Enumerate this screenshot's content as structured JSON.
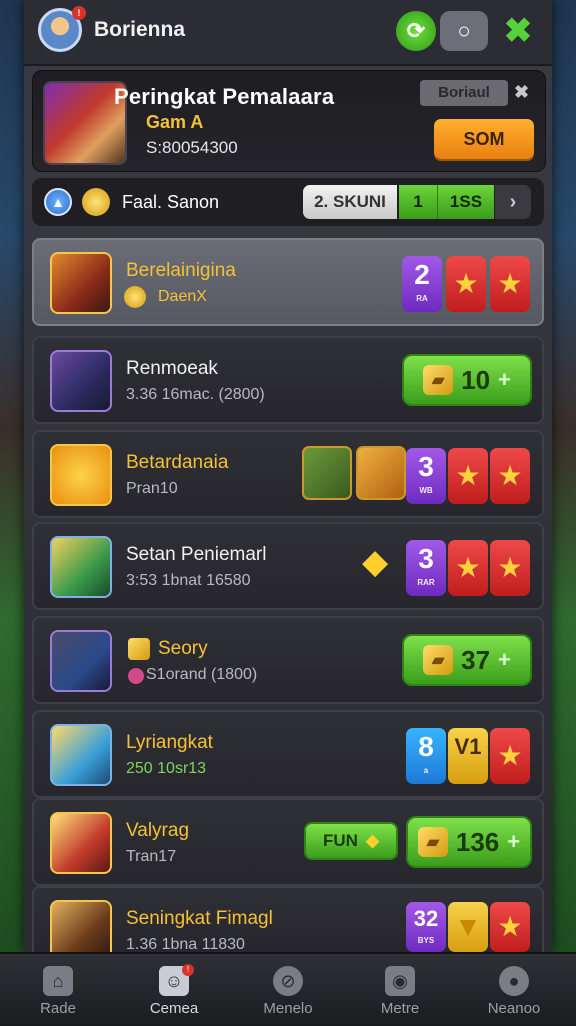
{
  "header": {
    "title": "Borienna",
    "avatar_badge": "!",
    "icons": [
      "refresh-icon",
      "settings-icon",
      "close-icon"
    ]
  },
  "profile": {
    "title": "Peringkat Pemalaara",
    "game": "Gam A",
    "score": "S:80054300",
    "grey_button": "Boriaul",
    "close": "✖",
    "action_button": "SOM"
  },
  "season": {
    "label": "Faal. Sanon",
    "segments": [
      "2. SKUNI",
      "1",
      "1SS",
      "›"
    ]
  },
  "rows": [
    {
      "name": "Berelainigina",
      "sub": "DaenX",
      "badge_num": "2",
      "badge_text": "RA",
      "stars": 2
    },
    {
      "name": "Renmoeak",
      "sub": "3.36 16mac. (2800)",
      "button_value": "10"
    },
    {
      "name": "Betardanaia",
      "sub": "Pran10",
      "badge_num": "3",
      "badge_text": "WB",
      "stars": 2
    },
    {
      "name": "Setan Peniemarl",
      "sub": "3:53 1bnat 16580",
      "badge_num": "3",
      "badge_text": "RAR",
      "stars": 2
    },
    {
      "name": "Seory",
      "sub": "S1orand (1800)",
      "button_value": "37"
    },
    {
      "name": "Lyriangkat",
      "sub": "250 10sr13",
      "badge_num": "8",
      "badge_text": "a",
      "badge2": "V1"
    },
    {
      "name": "Valyrag",
      "sub": "Tran17",
      "pill_label": "FUN",
      "button_value": "136"
    },
    {
      "name": "Seningkat Fimagl",
      "sub": "1.36 1bna 11830",
      "badge_num": "32",
      "badge_text": "BYS"
    }
  ],
  "nav": [
    {
      "label": "Rade",
      "icon": "home-icon"
    },
    {
      "label": "Cemea",
      "icon": "profile-card-icon",
      "badge": "!"
    },
    {
      "label": "Menelo",
      "icon": "compass-icon"
    },
    {
      "label": "Metre",
      "icon": "camera-icon"
    },
    {
      "label": "Neanoo",
      "icon": "person-icon"
    }
  ]
}
